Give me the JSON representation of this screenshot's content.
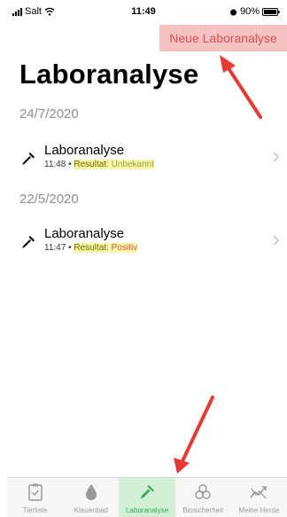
{
  "status_bar": {
    "carrier": "Salt",
    "time": "11:49",
    "battery": "90%"
  },
  "nav": {
    "add_button_label": "Neue Laboranalyse"
  },
  "page": {
    "title": "Laboranalyse"
  },
  "sections": [
    {
      "date": "24/7/2020",
      "item": {
        "title": "Laboranalyse",
        "time": "11:48",
        "separator": "•",
        "result_label": "Resultat:",
        "result_value": "Unbekannt"
      }
    },
    {
      "date": "22/5/2020",
      "item": {
        "title": "Laboranalyse",
        "time": "11:47",
        "separator": "•",
        "result_label": "Resultat:",
        "result_value": "Positiv"
      }
    }
  ],
  "tabs": [
    {
      "label": "Tierliste",
      "icon": "clipboard-check-icon",
      "active": false
    },
    {
      "label": "Klauenbad",
      "icon": "water-drop-icon",
      "active": false
    },
    {
      "label": "Laboranalyse",
      "icon": "pipette-icon",
      "active": true
    },
    {
      "label": "Biosicherheit",
      "icon": "biohazard-icon",
      "active": false
    },
    {
      "label": "Meine Herde",
      "icon": "herd-chart-icon",
      "active": false
    }
  ],
  "colors": {
    "accent_green": "#3aa552",
    "highlight_red": "#d9534f",
    "result_highlight": "#fbf8a5"
  }
}
